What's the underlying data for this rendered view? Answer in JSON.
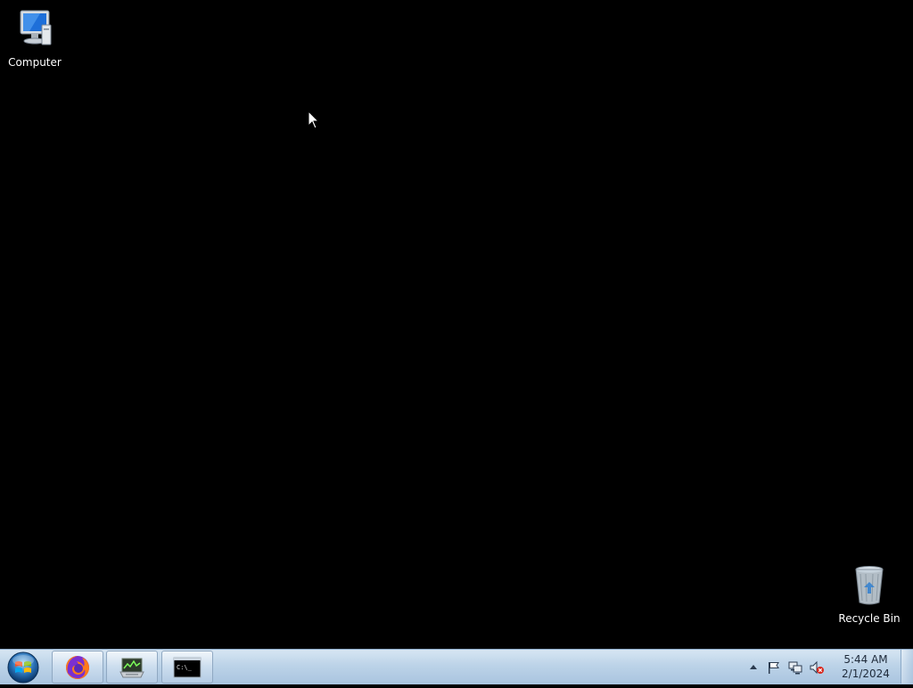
{
  "desktop": {
    "icons": {
      "computer": {
        "label": "Computer",
        "icon": "computer-icon"
      },
      "recycle_bin": {
        "label": "Recycle Bin",
        "icon": "recycle-bin-icon"
      }
    },
    "background_color": "#000000"
  },
  "taskbar": {
    "start_button": {
      "icon": "windows-orb-icon"
    },
    "pinned": [
      {
        "name": "firefox",
        "icon": "firefox-icon"
      },
      {
        "name": "network-monitor",
        "icon": "monitor-icon"
      },
      {
        "name": "command-prompt",
        "icon": "cmd-icon",
        "icon_text": "C:\\_"
      }
    ],
    "tray": {
      "icons": [
        "show-hidden-arrow-icon",
        "action-center-flag-icon",
        "network-icon",
        "volume-muted-icon"
      ],
      "clock": {
        "time": "5:44 AM",
        "date": "2/1/2024"
      }
    }
  }
}
